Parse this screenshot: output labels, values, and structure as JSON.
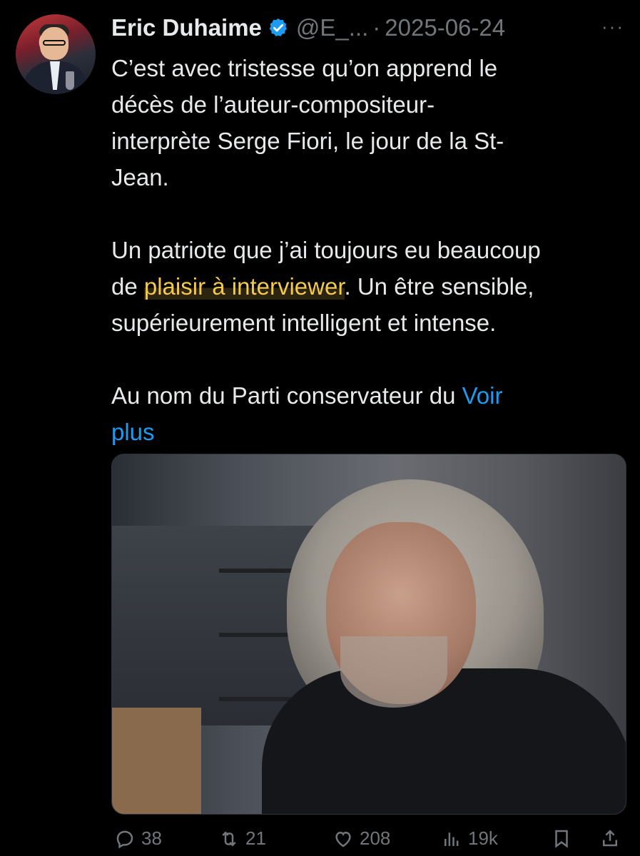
{
  "author": {
    "display_name": "Eric Duhaime",
    "handle": "@E_...",
    "date": "2025-06-24",
    "separator": "·",
    "more": "···"
  },
  "tweet": {
    "line1a": "C’est avec tristesse qu’on apprend le",
    "line1b": "décès de l’auteur-compositeur-",
    "line1c": "interprète Serge Fiori, le jour de la St-",
    "line1d": "Jean.",
    "p2_line1": "Un patriote que j’ai toujours eu beaucoup",
    "p2_line2_pre": "de ",
    "p2_line2_hl": "plaisir à interviewer",
    "p2_line2_post": ". Un être sensible,",
    "p2_line3": "supérieurement intelligent et intense.",
    "p3_line1_pre": "Au nom du Parti conservateur du ",
    "see_more_1": "Voir",
    "see_more_2": "plus"
  },
  "actions": {
    "replies": "38",
    "reposts": "21",
    "likes": "208",
    "views": "19k"
  },
  "colors": {
    "background": "#000000",
    "text": "#e7e9ea",
    "muted": "#71767b",
    "link": "#1d9bf0",
    "highlight": "#f2c94c"
  }
}
